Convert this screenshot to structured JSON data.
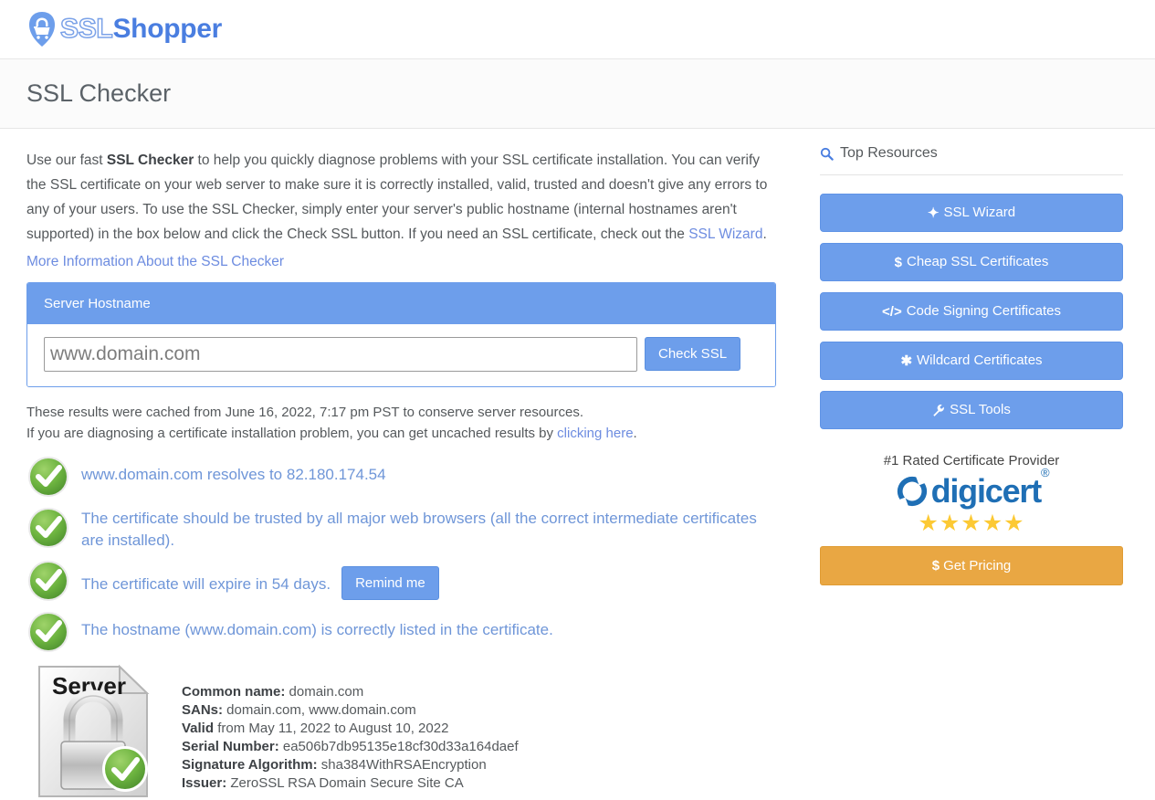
{
  "site": {
    "logo_ssl": "SSL",
    "logo_shopper": "Shopper",
    "logo_icon": "shield-cart-icon"
  },
  "page": {
    "title": "SSL Checker"
  },
  "intro": {
    "part1": "Use our fast ",
    "bold1": "SSL Checker",
    "part2": " to help you quickly diagnose problems with your SSL certificate installation. You can verify the SSL certificate on your web server to make sure it is correctly installed, valid, trusted and doesn't give any errors to any of your users. To use the SSL Checker, simply enter your server's public hostname (internal hostnames aren't supported) in the box below and click the Check SSL button. If you need an SSL certificate, check out the ",
    "link_text": "SSL Wizard",
    "part3": ".",
    "more_info_link": "More Information About the SSL Checker"
  },
  "form": {
    "panel_title": "Server Hostname",
    "hostname_placeholder": "www.domain.com",
    "hostname_value": "",
    "submit_label": "Check SSL"
  },
  "cache": {
    "line1": "These results were cached from June 16, 2022, 7:17 pm PST to conserve server resources.",
    "line2_prefix": "If you are diagnosing a certificate installation problem, you can get uncached results by ",
    "line2_link": "clicking here",
    "line2_suffix": "."
  },
  "results": [
    {
      "icon": "green-check-icon",
      "text": "www.domain.com resolves to 82.180.174.54",
      "button": null
    },
    {
      "icon": "green-check-icon",
      "text": "The certificate should be trusted by all major web browsers (all the correct intermediate certificates are installed).",
      "button": null
    },
    {
      "icon": "green-check-icon",
      "text": "The certificate will expire in 54 days.",
      "button": "Remind me"
    },
    {
      "icon": "green-check-icon",
      "text": "The hostname (www.domain.com) is correctly listed in the certificate.",
      "button": null
    }
  ],
  "certificate": {
    "icon": "server-certificate-lock-icon",
    "icon_label": "Server",
    "rows": [
      {
        "label": "Common name:",
        "value": " domain.com"
      },
      {
        "label": "SANs:",
        "value": " domain.com, www.domain.com"
      },
      {
        "label": "Valid",
        "value": " from May 11, 2022 to August 10, 2022"
      },
      {
        "label": "Serial Number:",
        "value": " ea506b7db95135e18cf30d33a164daef"
      },
      {
        "label": "Signature Algorithm:",
        "value": " sha384WithRSAEncryption"
      },
      {
        "label": "Issuer:",
        "value": " ZeroSSL RSA Domain Secure Site CA"
      }
    ]
  },
  "sidebar": {
    "heading": "Top Resources",
    "heading_icon": "search-icon",
    "buttons": [
      {
        "icon": "magic-wand-icon",
        "glyph": "✦",
        "label": "SSL Wizard"
      },
      {
        "icon": "dollar-icon",
        "glyph": "$",
        "label": "Cheap SSL Certificates"
      },
      {
        "icon": "code-icon",
        "glyph": "</>",
        "label": "Code Signing Certificates"
      },
      {
        "icon": "asterisk-icon",
        "glyph": "✱",
        "label": "Wildcard Certificates"
      },
      {
        "icon": "wrench-icon",
        "glyph": "🔧",
        "label": "SSL Tools"
      }
    ],
    "promo": {
      "title": "#1 Rated Certificate Provider",
      "brand": "digicert",
      "brand_mark": "digicert-logo-icon",
      "registered": "®",
      "stars": "★★★★★",
      "star_count": 5,
      "cta_glyph": "$",
      "cta_label": "Get Pricing"
    }
  },
  "colors": {
    "blue": "#6d9eeb",
    "link_blue": "#6d8ce0",
    "result_text": "#6f96d8",
    "orange": "#e9a743",
    "star_yellow": "#fcc934",
    "digicert_blue": "#1f6fb5",
    "check_green": "#5aa832"
  }
}
